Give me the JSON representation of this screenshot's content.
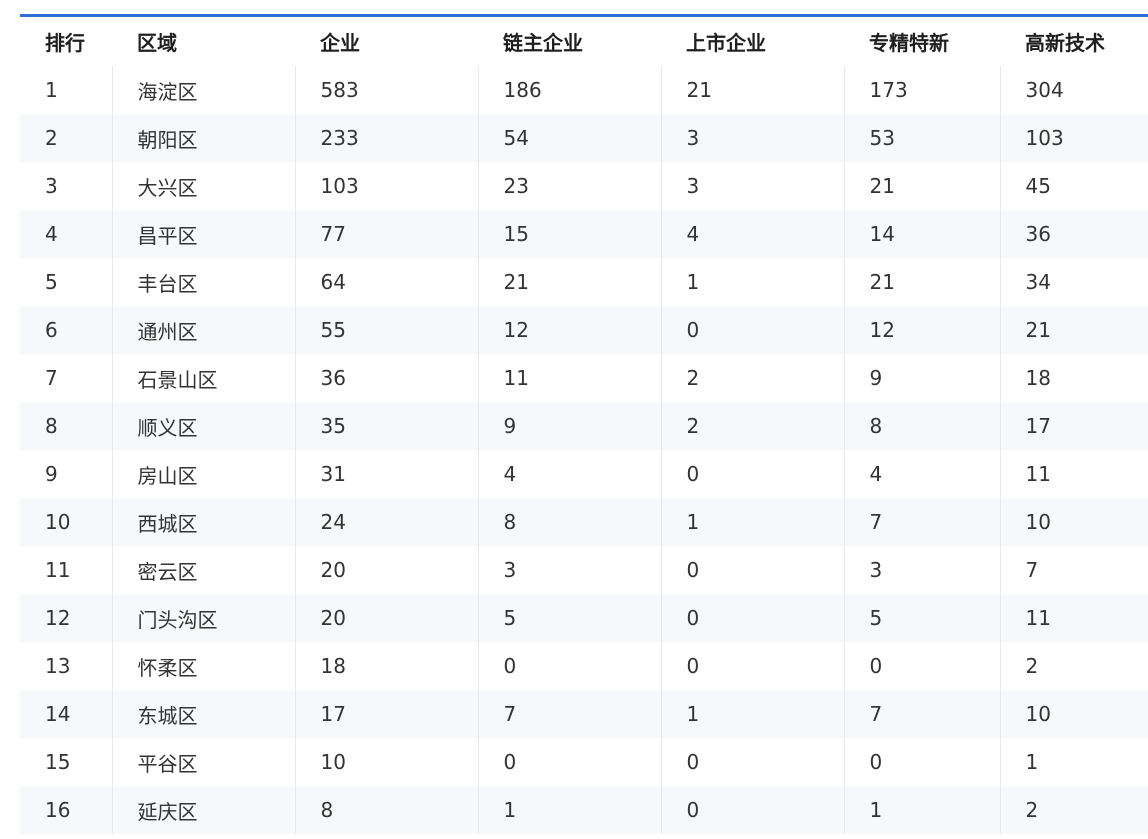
{
  "table": {
    "headers": [
      "排行",
      "区域",
      "企业",
      "链主企业",
      "上市企业",
      "专精特新",
      "高新技术"
    ],
    "rows": [
      [
        "1",
        "海淀区",
        "583",
        "186",
        "21",
        "173",
        "304"
      ],
      [
        "2",
        "朝阳区",
        "233",
        "54",
        "3",
        "53",
        "103"
      ],
      [
        "3",
        "大兴区",
        "103",
        "23",
        "3",
        "21",
        "45"
      ],
      [
        "4",
        "昌平区",
        "77",
        "15",
        "4",
        "14",
        "36"
      ],
      [
        "5",
        "丰台区",
        "64",
        "21",
        "1",
        "21",
        "34"
      ],
      [
        "6",
        "通州区",
        "55",
        "12",
        "0",
        "12",
        "21"
      ],
      [
        "7",
        "石景山区",
        "36",
        "11",
        "2",
        "9",
        "18"
      ],
      [
        "8",
        "顺义区",
        "35",
        "9",
        "2",
        "8",
        "17"
      ],
      [
        "9",
        "房山区",
        "31",
        "4",
        "0",
        "4",
        "11"
      ],
      [
        "10",
        "西城区",
        "24",
        "8",
        "1",
        "7",
        "10"
      ],
      [
        "11",
        "密云区",
        "20",
        "3",
        "0",
        "3",
        "7"
      ],
      [
        "12",
        "门头沟区",
        "20",
        "5",
        "0",
        "5",
        "11"
      ],
      [
        "13",
        "怀柔区",
        "18",
        "0",
        "0",
        "0",
        "2"
      ],
      [
        "14",
        "东城区",
        "17",
        "7",
        "1",
        "7",
        "10"
      ],
      [
        "15",
        "平谷区",
        "10",
        "0",
        "0",
        "0",
        "1"
      ],
      [
        "16",
        "延庆区",
        "8",
        "1",
        "0",
        "1",
        "2"
      ]
    ]
  }
}
